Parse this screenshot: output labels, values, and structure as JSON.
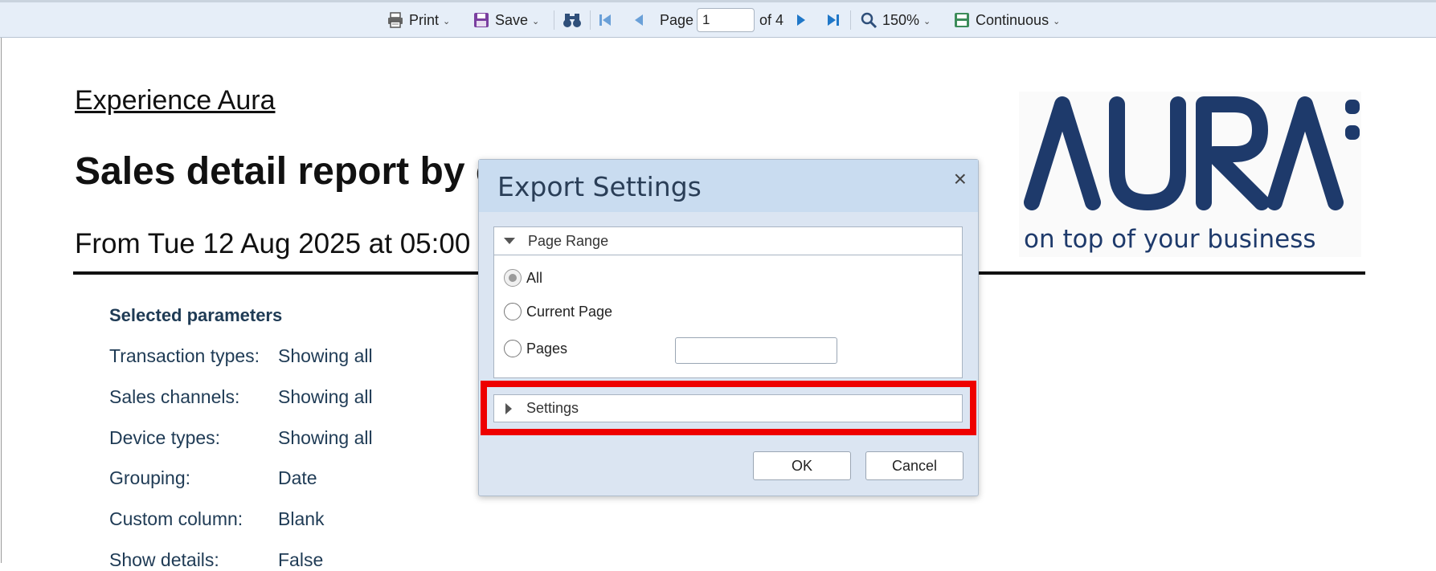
{
  "toolbar": {
    "print_label": "Print",
    "save_label": "Save",
    "page_label": "Page",
    "page_value": "1",
    "of_label": "of 4",
    "zoom_label": "150%",
    "view_label": "Continuous"
  },
  "report": {
    "link_title": "Experience Aura",
    "heading": "Sales detail report by c",
    "subheading": "From Tue 12 Aug 2025 at 05:00",
    "params_heading": "Selected parameters",
    "params": [
      {
        "label": "Transaction types:",
        "value": "Showing all"
      },
      {
        "label": "Sales channels:",
        "value": "Showing all"
      },
      {
        "label": "Device types:",
        "value": "Showing all"
      },
      {
        "label": "Grouping:",
        "value": "Date"
      },
      {
        "label": "Custom column:",
        "value": "Blank"
      },
      {
        "label": "Show details:",
        "value": "False"
      }
    ]
  },
  "logo": {
    "wordmark": "AURA",
    "tagline": "on top of your business",
    "color": "#1e3a6b"
  },
  "dialog": {
    "title": "Export Settings",
    "close_glyph": "×",
    "page_range_label": "Page Range",
    "options": {
      "all": "All",
      "current": "Current Page",
      "pages": "Pages"
    },
    "selected_option": "All",
    "pages_value": "",
    "settings_label": "Settings",
    "ok_label": "OK",
    "cancel_label": "Cancel"
  },
  "colors": {
    "toolbar_bg": "#e6eef8",
    "dialog_bg": "#dbe5f2",
    "dialog_header_bg": "#c9dcf0",
    "highlight": "#ee0000",
    "param_text": "#1f3b55"
  }
}
